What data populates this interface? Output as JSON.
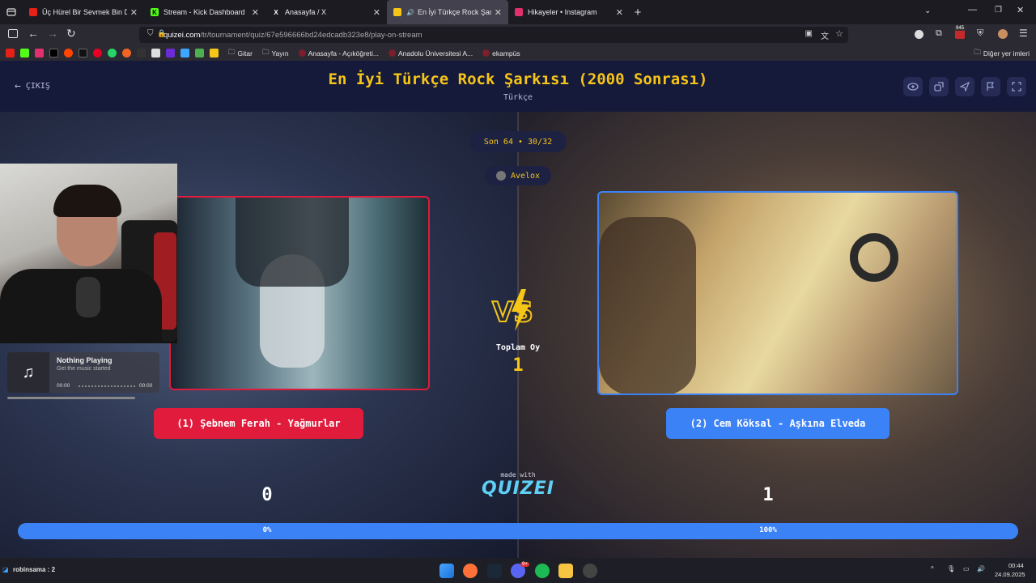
{
  "browser": {
    "tabs": [
      {
        "label": "Üç Hürel Bir Sevmek Bin Defa Ö",
        "color": "#e62117"
      },
      {
        "label": "Stream - Kick Dashboard",
        "color": "#53fc18"
      },
      {
        "label": "Anasayfa / X",
        "color": "#ffffff"
      },
      {
        "label": "En İyi Türkçe Rock Şarkısı (2",
        "color": "#f5c518"
      },
      {
        "label": "Hikayeler • Instagram",
        "color": "#e1306c"
      }
    ],
    "url_domain": "quizei.com",
    "url_path": "/tr/tournament/quiz/67e596666bd24edcadb323e8/play-on-stream",
    "bookmarks": [
      "Gitar",
      "Yayın",
      "Anasayfa - Açıköğreti...",
      "Anadolu Üniversitesi A...",
      "ekampüs"
    ],
    "other_bookmarks": "Diğer yer imleri",
    "badge": "945"
  },
  "quiz": {
    "exit_label": "ÇIKIŞ",
    "title": "En İyi Türkçe Rock Şarkısı (2000 Sonrası)",
    "subtitle": "Türkçe",
    "round": "Son 64 • 30/32",
    "user": "Avelox",
    "total_label": "Toplam Oy",
    "total_value": "1",
    "left": {
      "label": "(1) Şebnem Ferah - Yağmurlar",
      "votes": "0",
      "percent_label": "0%",
      "percent": 0,
      "color": "#e01b3c"
    },
    "right": {
      "label": "(2) Cem Köksal - Aşkına Elveda",
      "votes": "1",
      "percent_label": "100%",
      "percent": 100,
      "color": "#3b82f6"
    },
    "made_with": "made with",
    "brand": "QUIZEI"
  },
  "overlay": {
    "now_playing": "Nothing Playing",
    "sub": "Get the music started",
    "time_start": "00:00",
    "time_end": "00:00"
  },
  "taskbar": {
    "left_text": "robinsama : 2",
    "time": "00:44",
    "date": "24.09.2025",
    "discord_badge": "9+"
  }
}
